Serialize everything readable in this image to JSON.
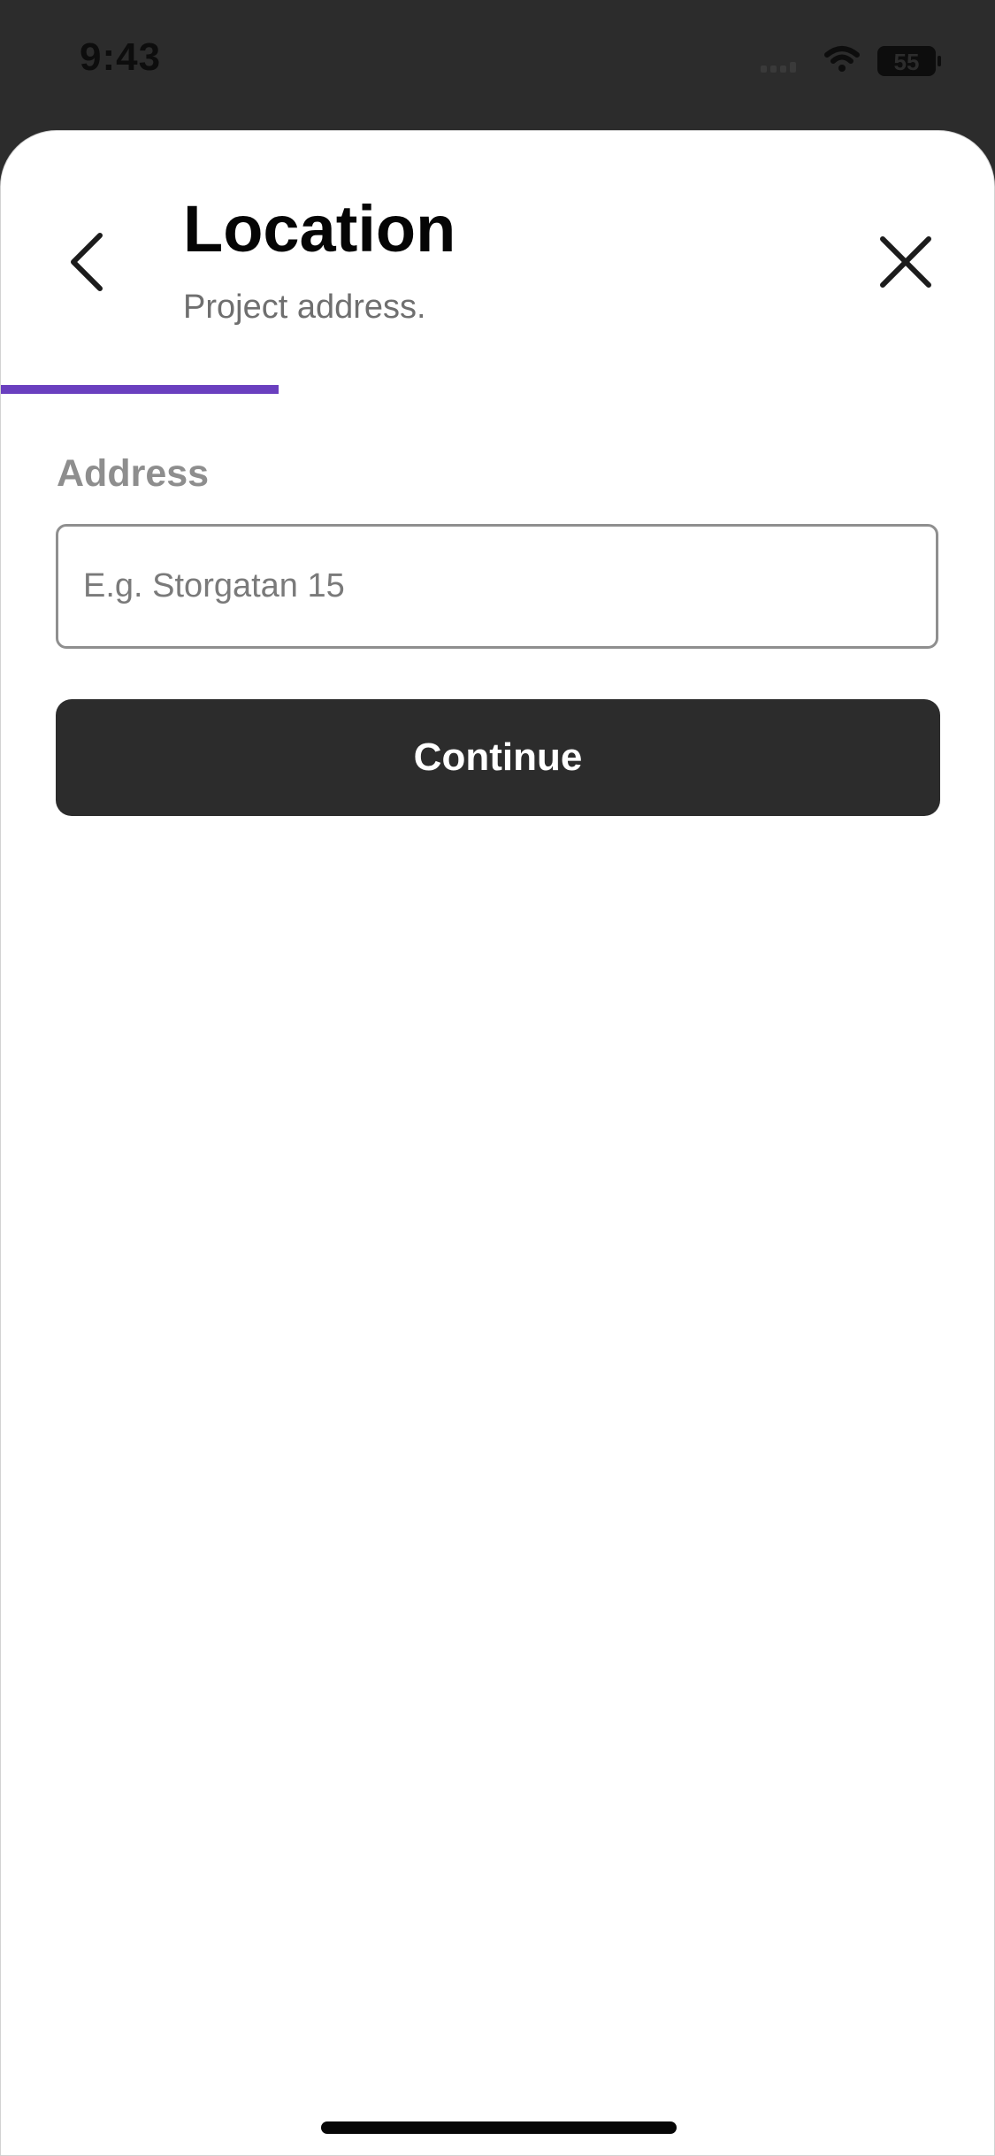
{
  "status_bar": {
    "time": "9:43",
    "battery_level": "55",
    "icons": [
      "cellular-signal-icon",
      "wifi-icon",
      "battery-icon"
    ]
  },
  "header": {
    "title": "Location",
    "subtitle": "Project address.",
    "back_icon": "chevron-left-icon",
    "close_icon": "close-icon"
  },
  "progress": {
    "fraction": 0.28,
    "color": "#6a3fbf"
  },
  "form": {
    "address_label": "Address",
    "address_value": "",
    "address_placeholder": "E.g. Storgatan 15",
    "continue_label": "Continue"
  },
  "colors": {
    "primary_button": "#2c2c2c",
    "accent": "#6a3fbf"
  }
}
